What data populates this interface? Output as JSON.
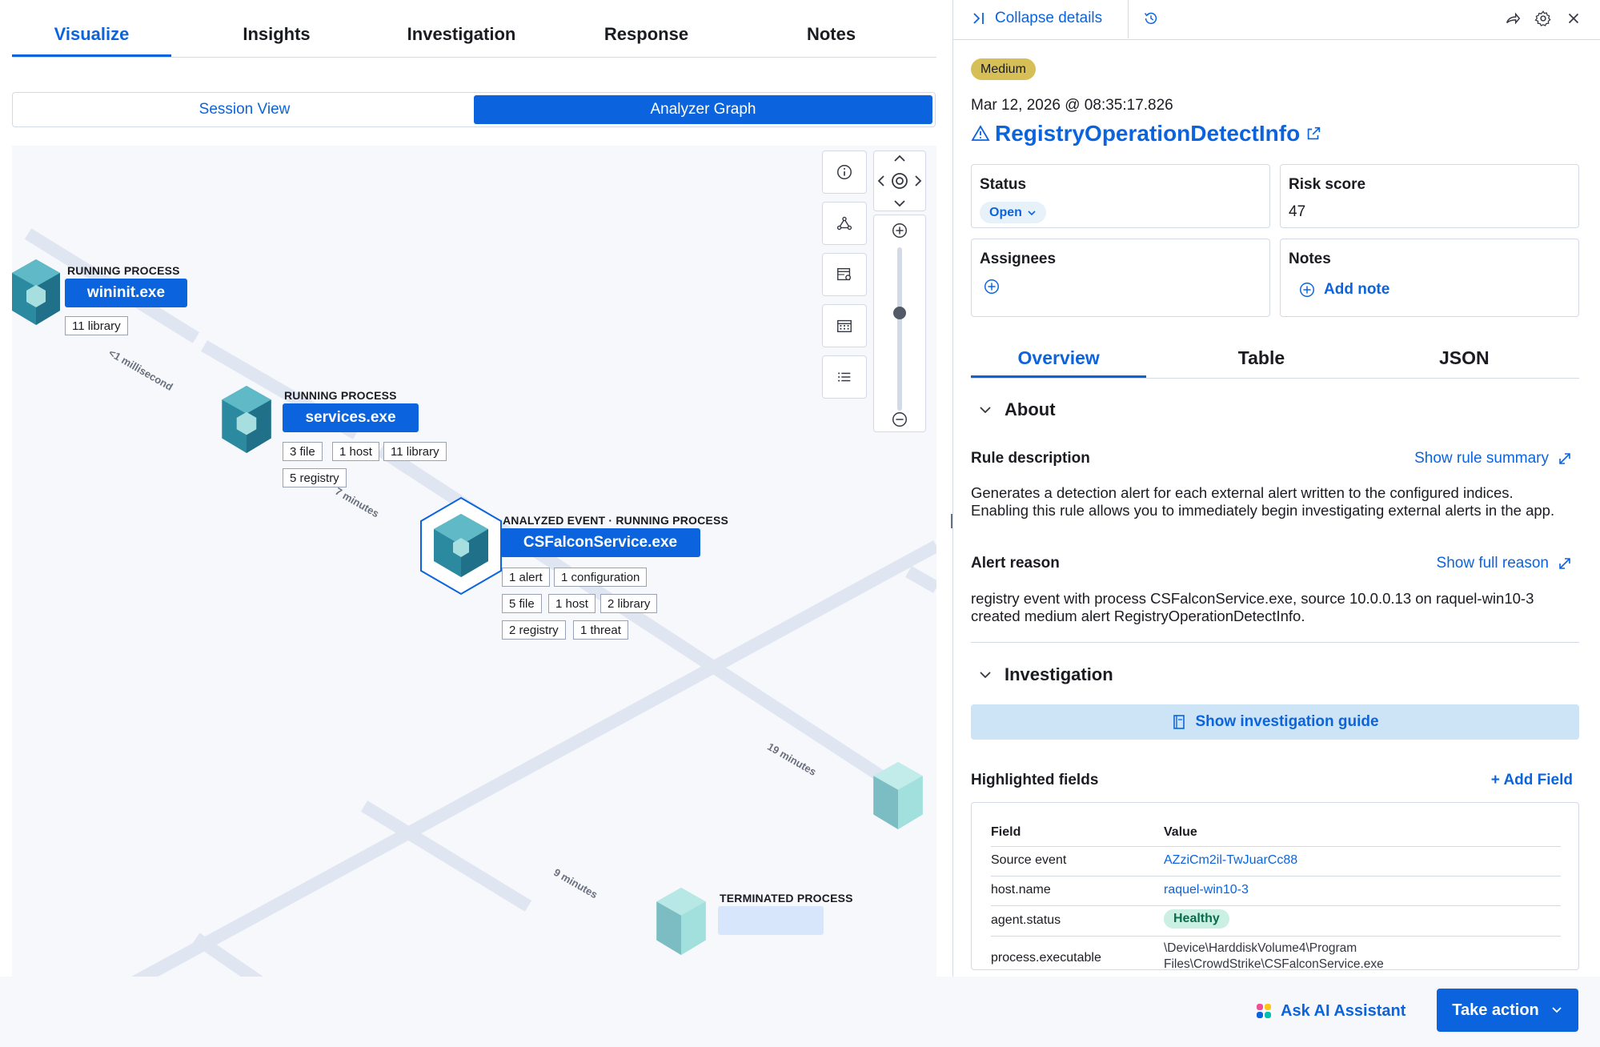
{
  "tabs": [
    {
      "label": "Visualize",
      "active": true
    },
    {
      "label": "Insights"
    },
    {
      "label": "Investigation"
    },
    {
      "label": "Response"
    },
    {
      "label": "Notes"
    }
  ],
  "view_toggle": {
    "session": "Session View",
    "analyzer": "Analyzer Graph",
    "selected": "Analyzer Graph"
  },
  "graph": {
    "nodes": [
      {
        "type": "RUNNING PROCESS",
        "name": "wininit.exe",
        "chips": [
          "11 library"
        ]
      },
      {
        "type": "RUNNING PROCESS",
        "name": "services.exe",
        "chips": [
          "3 file",
          "1 host",
          "11 library",
          "5 registry"
        ]
      },
      {
        "type": "ANALYZED EVENT · RUNNING PROCESS",
        "name": "CSFalconService.exe",
        "chips": [
          "1 alert",
          "1 configuration",
          "5 file",
          "1 host",
          "2 library",
          "2 registry",
          "1 threat"
        ]
      },
      {
        "type": "TERMINATED PROCESS",
        "name": ""
      }
    ],
    "edges": [
      "<1 millisecond",
      "7 minutes",
      "19 minutes",
      "9 minutes"
    ],
    "colors": {
      "cube_dark": "#2b8a9f",
      "cube_light": "#8fd8d6",
      "edge": "#dfe6f2",
      "accent": "#0b64dd"
    }
  },
  "details": {
    "collapse_label": "Collapse details",
    "severity": "Medium",
    "timestamp": "Mar 12, 2026 @ 08:35:17.826",
    "title": "RegistryOperationDetectInfo",
    "status": {
      "label": "Status",
      "value": "Open"
    },
    "risk": {
      "label": "Risk score",
      "value": "47"
    },
    "assignees": {
      "label": "Assignees"
    },
    "notes": {
      "label": "Notes",
      "add": "Add note"
    },
    "tabs": [
      {
        "label": "Overview",
        "active": true
      },
      {
        "label": "Table"
      },
      {
        "label": "JSON"
      }
    ],
    "about": {
      "heading": "About",
      "rule_description_label": "Rule description",
      "show_rule_summary": "Show rule summary",
      "rule_description": "Generates a detection alert for each external alert written to the configured indices. Enabling this rule allows you to immediately begin investigating external alerts in the app.",
      "alert_reason_label": "Alert reason",
      "show_full_reason": "Show full reason",
      "alert_reason": "registry event with process CSFalconService.exe, source 10.0.0.13 on raquel-win10-3 created medium alert RegistryOperationDetectInfo."
    },
    "investigation": {
      "heading": "Investigation",
      "guide_button": "Show investigation guide",
      "highlighted_label": "Highlighted fields",
      "add_field": "+ Add Field",
      "col_field": "Field",
      "col_value": "Value",
      "rows": [
        {
          "field": "Source event",
          "value": "AZziCm2il-TwJuarCc88"
        },
        {
          "field": "host.name",
          "value": "raquel-win10-3"
        },
        {
          "field": "agent.status",
          "value": "Healthy"
        },
        {
          "field": "process.executable",
          "value": "\\Device\\HarddiskVolume4\\Program Files\\CrowdStrike\\CSFalconService.exe"
        }
      ]
    }
  },
  "footer": {
    "ai": "Ask AI Assistant",
    "action": "Take action"
  }
}
